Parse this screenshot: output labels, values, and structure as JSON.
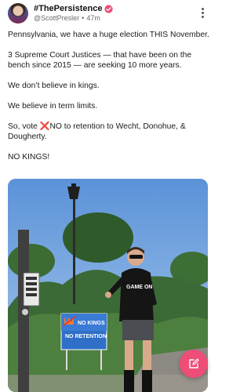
{
  "post": {
    "author": {
      "display_name": "#ThePersistence",
      "handle": "@ScottPresler",
      "time_ago": "47m",
      "verified_icon": "verified-badge-icon"
    },
    "paragraphs": [
      "Pennsylvania, we have a huge election THIS November.",
      "3 Supreme Court Justices — that have been on the bench since 2015 — are seeking 10 more years.",
      "We don’t believe in kings.",
      "We believe in term limits."
    ],
    "vote_line": {
      "prefix": "So, vote ",
      "emoji": "❌",
      "suffix": "NO to retention to Wecht, Donohue, & Dougherty."
    },
    "closing": "NO KINGS!",
    "image": {
      "sign_line1": "NO KINGS",
      "sign_line2": "NO RETENTION",
      "shirt_text": "GAME ON"
    }
  },
  "ui": {
    "compose_icon": "compose-icon",
    "more_icon": "more-vertical-icon",
    "fab_color": "#ee4d78",
    "verified_color": "#ee4d78"
  }
}
